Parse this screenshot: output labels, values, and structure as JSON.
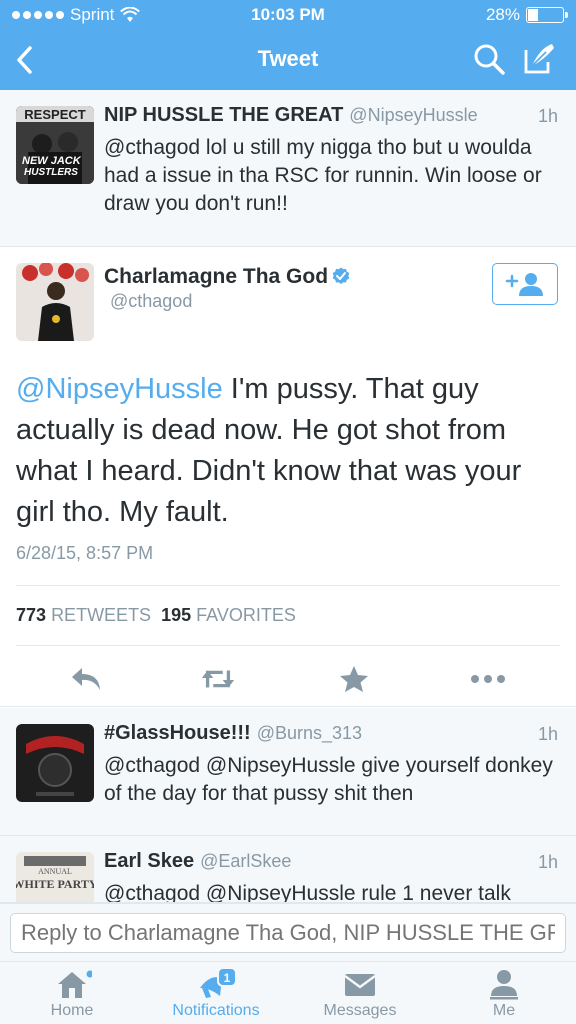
{
  "status_bar": {
    "carrier": "Sprint",
    "time": "10:03 PM",
    "battery": "28%",
    "battery_level": 0.28
  },
  "nav": {
    "title": "Tweet",
    "back_icon": "chevron-left-icon",
    "search_icon": "search-icon",
    "compose_icon": "compose-icon"
  },
  "prev_tweet": {
    "name": "NIP HUSSLE THE GREAT",
    "handle": "@NipseyHussle",
    "time": "1h",
    "text_mention": "@cthagod",
    "text_rest": " lol u still my nigga tho but u woulda had a issue in tha RSC for runnin. Win loose or draw you don't run!!",
    "avatar_text_top": "RESPECT",
    "avatar_text_mid": "NEW JACK",
    "avatar_text_bot": "HUSTLERS"
  },
  "main_tweet": {
    "name": "Charlamagne Tha God",
    "handle": "@cthagod",
    "mention": "@NipseyHussle",
    "text": " I'm pussy. That guy actually is dead now. He got shot from what I heard. Didn't know that was your girl tho. My fault.",
    "timestamp": "6/28/15, 8:57 PM",
    "retweets_count": "773",
    "retweets_label": "RETWEETS",
    "favorites_count": "195",
    "favorites_label": "FAVORITES"
  },
  "replies": [
    {
      "name": "#GlassHouse!!!",
      "handle": "@Burns_313",
      "time": "1h",
      "text": "@cthagod @NipseyHussle give yourself donkey  of the day for that pussy shit then"
    },
    {
      "name": "Earl Skee",
      "handle": "@EarlSkee",
      "time": "1h",
      "text": "@cthagod @NipseyHussle rule 1 never talk",
      "avatar_text_1": "ANNUAL",
      "avatar_text_2": "WHITE PARTY"
    }
  ],
  "reply_bar": {
    "placeholder": "Reply to Charlamagne Tha God, NIP HUSSLE THE GREAT"
  },
  "tabs": [
    {
      "label": "Home",
      "icon": "home-icon"
    },
    {
      "label": "Notifications",
      "icon": "notifications-icon",
      "badge": "1"
    },
    {
      "label": "Messages",
      "icon": "messages-icon"
    },
    {
      "label": "Me",
      "icon": "profile-icon"
    }
  ],
  "colors": {
    "accent": "#55acee",
    "secondary_text": "#8899a6",
    "text": "#292f33",
    "background_alt": "#f5f8fa"
  }
}
